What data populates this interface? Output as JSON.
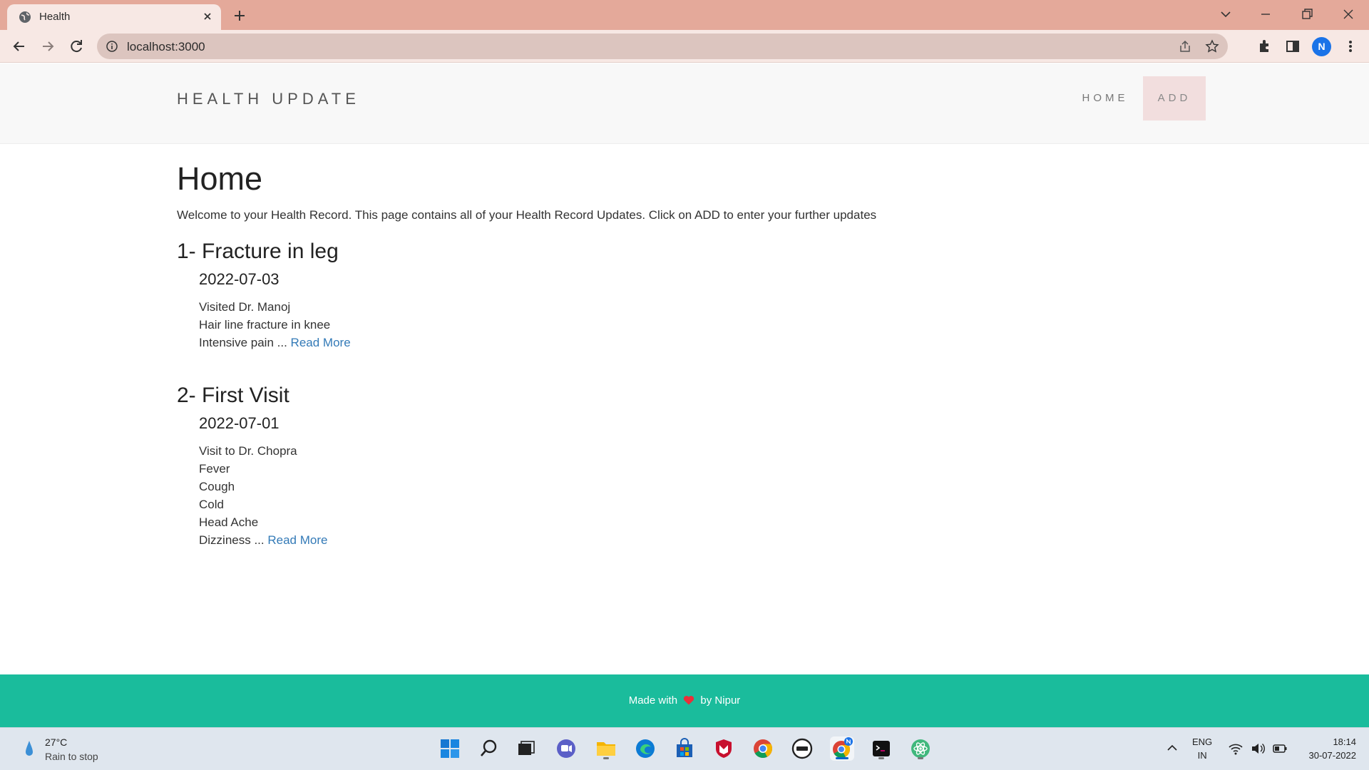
{
  "browser": {
    "tab_title": "Health",
    "url": "localhost:3000",
    "profile_initial": "N"
  },
  "site": {
    "brand": "HEALTH UPDATE",
    "nav": {
      "home": "HOME",
      "add": "ADD"
    },
    "page_title": "Home",
    "welcome": "Welcome to your Health Record. This page contains all of your Health Record Updates. Click on ADD to enter your further updates",
    "entries": [
      {
        "title": "1- Fracture in leg",
        "date": "2022-07-03",
        "lines": [
          "Visited Dr. Manoj",
          "Hair line fracture in knee",
          "Intensive pain ..."
        ],
        "read_more": "Read More"
      },
      {
        "title": "2- First Visit",
        "date": "2022-07-01",
        "lines": [
          "Visit to Dr. Chopra",
          "Fever",
          "Cough",
          "Cold",
          "Head Ache",
          "Dizziness ..."
        ],
        "read_more": "Read More"
      }
    ],
    "footer": {
      "made_with": "Made with",
      "by": "by Nipur"
    },
    "colors": {
      "footer_bg": "#1abc9c",
      "link": "#337ab7",
      "add_active_bg": "#f2dede"
    }
  },
  "taskbar": {
    "weather_temp": "27°C",
    "weather_desc": "Rain to stop",
    "language": "ENG",
    "region": "IN",
    "time": "18:14",
    "date": "30-07-2022"
  }
}
